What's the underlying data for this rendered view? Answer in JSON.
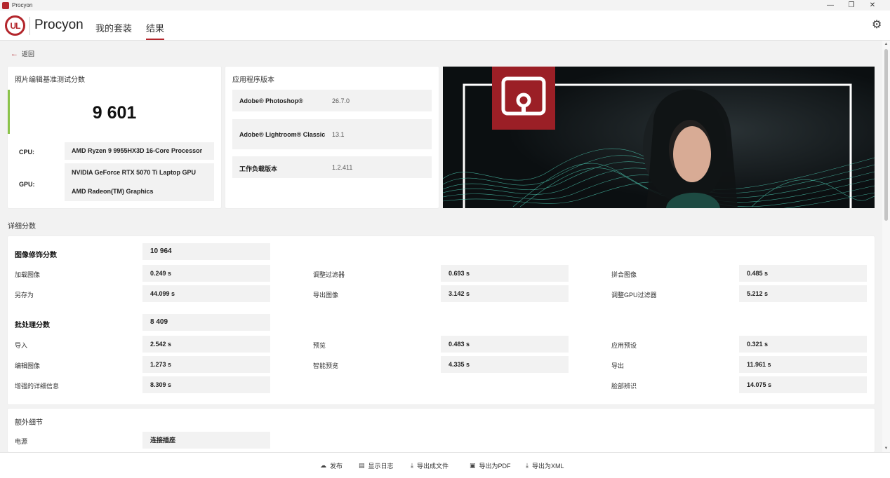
{
  "window": {
    "title": "Procyon",
    "controls": [
      "—",
      "❐",
      "✕"
    ]
  },
  "header": {
    "logo_text": "UL",
    "brand": "Procyon",
    "tabs": [
      {
        "label": "我的套装"
      },
      {
        "label": "结果"
      }
    ],
    "active_tab": "结果"
  },
  "back_label": "返回",
  "score_card": {
    "title": "照片编辑基准测试分数",
    "score": "9 601",
    "cpu_label": "CPU:",
    "cpu": "AMD Ryzen 9 9955HX3D 16-Core Processor",
    "gpu_label": "GPU:",
    "gpus": [
      "NVIDIA GeForce RTX 5070 Ti Laptop GPU",
      "AMD Radeon(TM) Graphics"
    ]
  },
  "version_card": {
    "title": "应用程序版本",
    "rows": [
      {
        "name": "Adobe® Photoshop®",
        "value": "26.7.0"
      },
      {
        "name": "Adobe® Lightroom® Classic",
        "value": "13.1"
      },
      {
        "name": "工作负载版本",
        "value": "1.2.411"
      }
    ]
  },
  "details": {
    "title": "详细分数",
    "groups": [
      {
        "name": "图像修饰分数",
        "score": "10 964",
        "items": [
          {
            "label": "加载图像",
            "value": "0.249 s"
          },
          {
            "label": "调整过滤器",
            "value": "0.693 s"
          },
          {
            "label": "拼合图像",
            "value": "0.485 s"
          },
          {
            "label": "另存为",
            "value": "44.099 s"
          },
          {
            "label": "导出图像",
            "value": "3.142 s"
          },
          {
            "label": "调整GPU过滤器",
            "value": "5.212 s"
          }
        ]
      },
      {
        "name": "批处理分数",
        "score": "8 409",
        "items": [
          {
            "label": "导入",
            "value": "2.542 s"
          },
          {
            "label": "预览",
            "value": "0.483 s"
          },
          {
            "label": "应用预设",
            "value": "0.321 s"
          },
          {
            "label": "编辑图像",
            "value": "1.273 s"
          },
          {
            "label": "智能预览",
            "value": "4.335 s"
          },
          {
            "label": "导出",
            "value": "11.961 s"
          },
          {
            "label": "增强的详细信息",
            "value": "8.309 s"
          },
          {
            "label": "脸部辨识",
            "value": "14.075 s"
          }
        ]
      }
    ]
  },
  "extra": {
    "title": "额外细节",
    "rows": [
      {
        "label": "电源",
        "value": "连接插座"
      }
    ]
  },
  "footer": {
    "buttons": [
      {
        "label": "发布",
        "icon": "cloud-upload-icon"
      },
      {
        "label": "显示日志",
        "icon": "document-icon"
      },
      {
        "label": "导出成文件",
        "icon": "download-icon"
      },
      {
        "label": "导出为PDF",
        "icon": "save-icon"
      },
      {
        "label": "导出为XML",
        "icon": "download-icon"
      }
    ]
  },
  "colors": {
    "accent": "#b3262c",
    "score_bar": "#8bc34a",
    "hero_wave": "#4fd1b8"
  }
}
